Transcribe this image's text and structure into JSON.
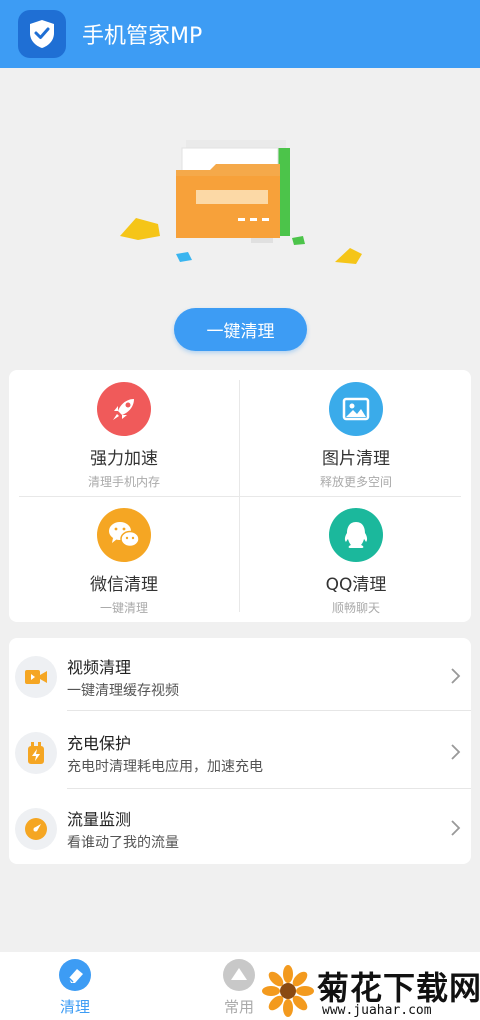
{
  "app": {
    "title": "手机管家MP"
  },
  "main": {
    "clean_button": "一键清理"
  },
  "grid": [
    {
      "title": "强力加速",
      "subtitle": "清理手机内存",
      "icon": "rocket-icon",
      "color": "#f05a5a"
    },
    {
      "title": "图片清理",
      "subtitle": "释放更多空间",
      "icon": "image-icon",
      "color": "#3aabea"
    },
    {
      "title": "微信清理",
      "subtitle": "一键清理",
      "icon": "wechat-icon",
      "color": "#f5a623"
    },
    {
      "title": "QQ清理",
      "subtitle": "顺畅聊天",
      "icon": "qq-icon",
      "color": "#1bb89c"
    }
  ],
  "list": [
    {
      "title": "视频清理",
      "subtitle": "一键清理缓存视频",
      "icon": "video-icon"
    },
    {
      "title": "充电保护",
      "subtitle": "充电时清理耗电应用，加速充电",
      "icon": "charge-icon"
    },
    {
      "title": "流量监测",
      "subtitle": "看谁动了我的流量",
      "icon": "traffic-icon"
    }
  ],
  "tabs": [
    {
      "label": "清理",
      "active": true
    },
    {
      "label": "常用",
      "active": false
    }
  ],
  "watermark": {
    "text": "菊花下载网",
    "url": "www.juahar.com"
  },
  "colors": {
    "primary": "#3d9cf4",
    "background": "#f0f0f0"
  }
}
